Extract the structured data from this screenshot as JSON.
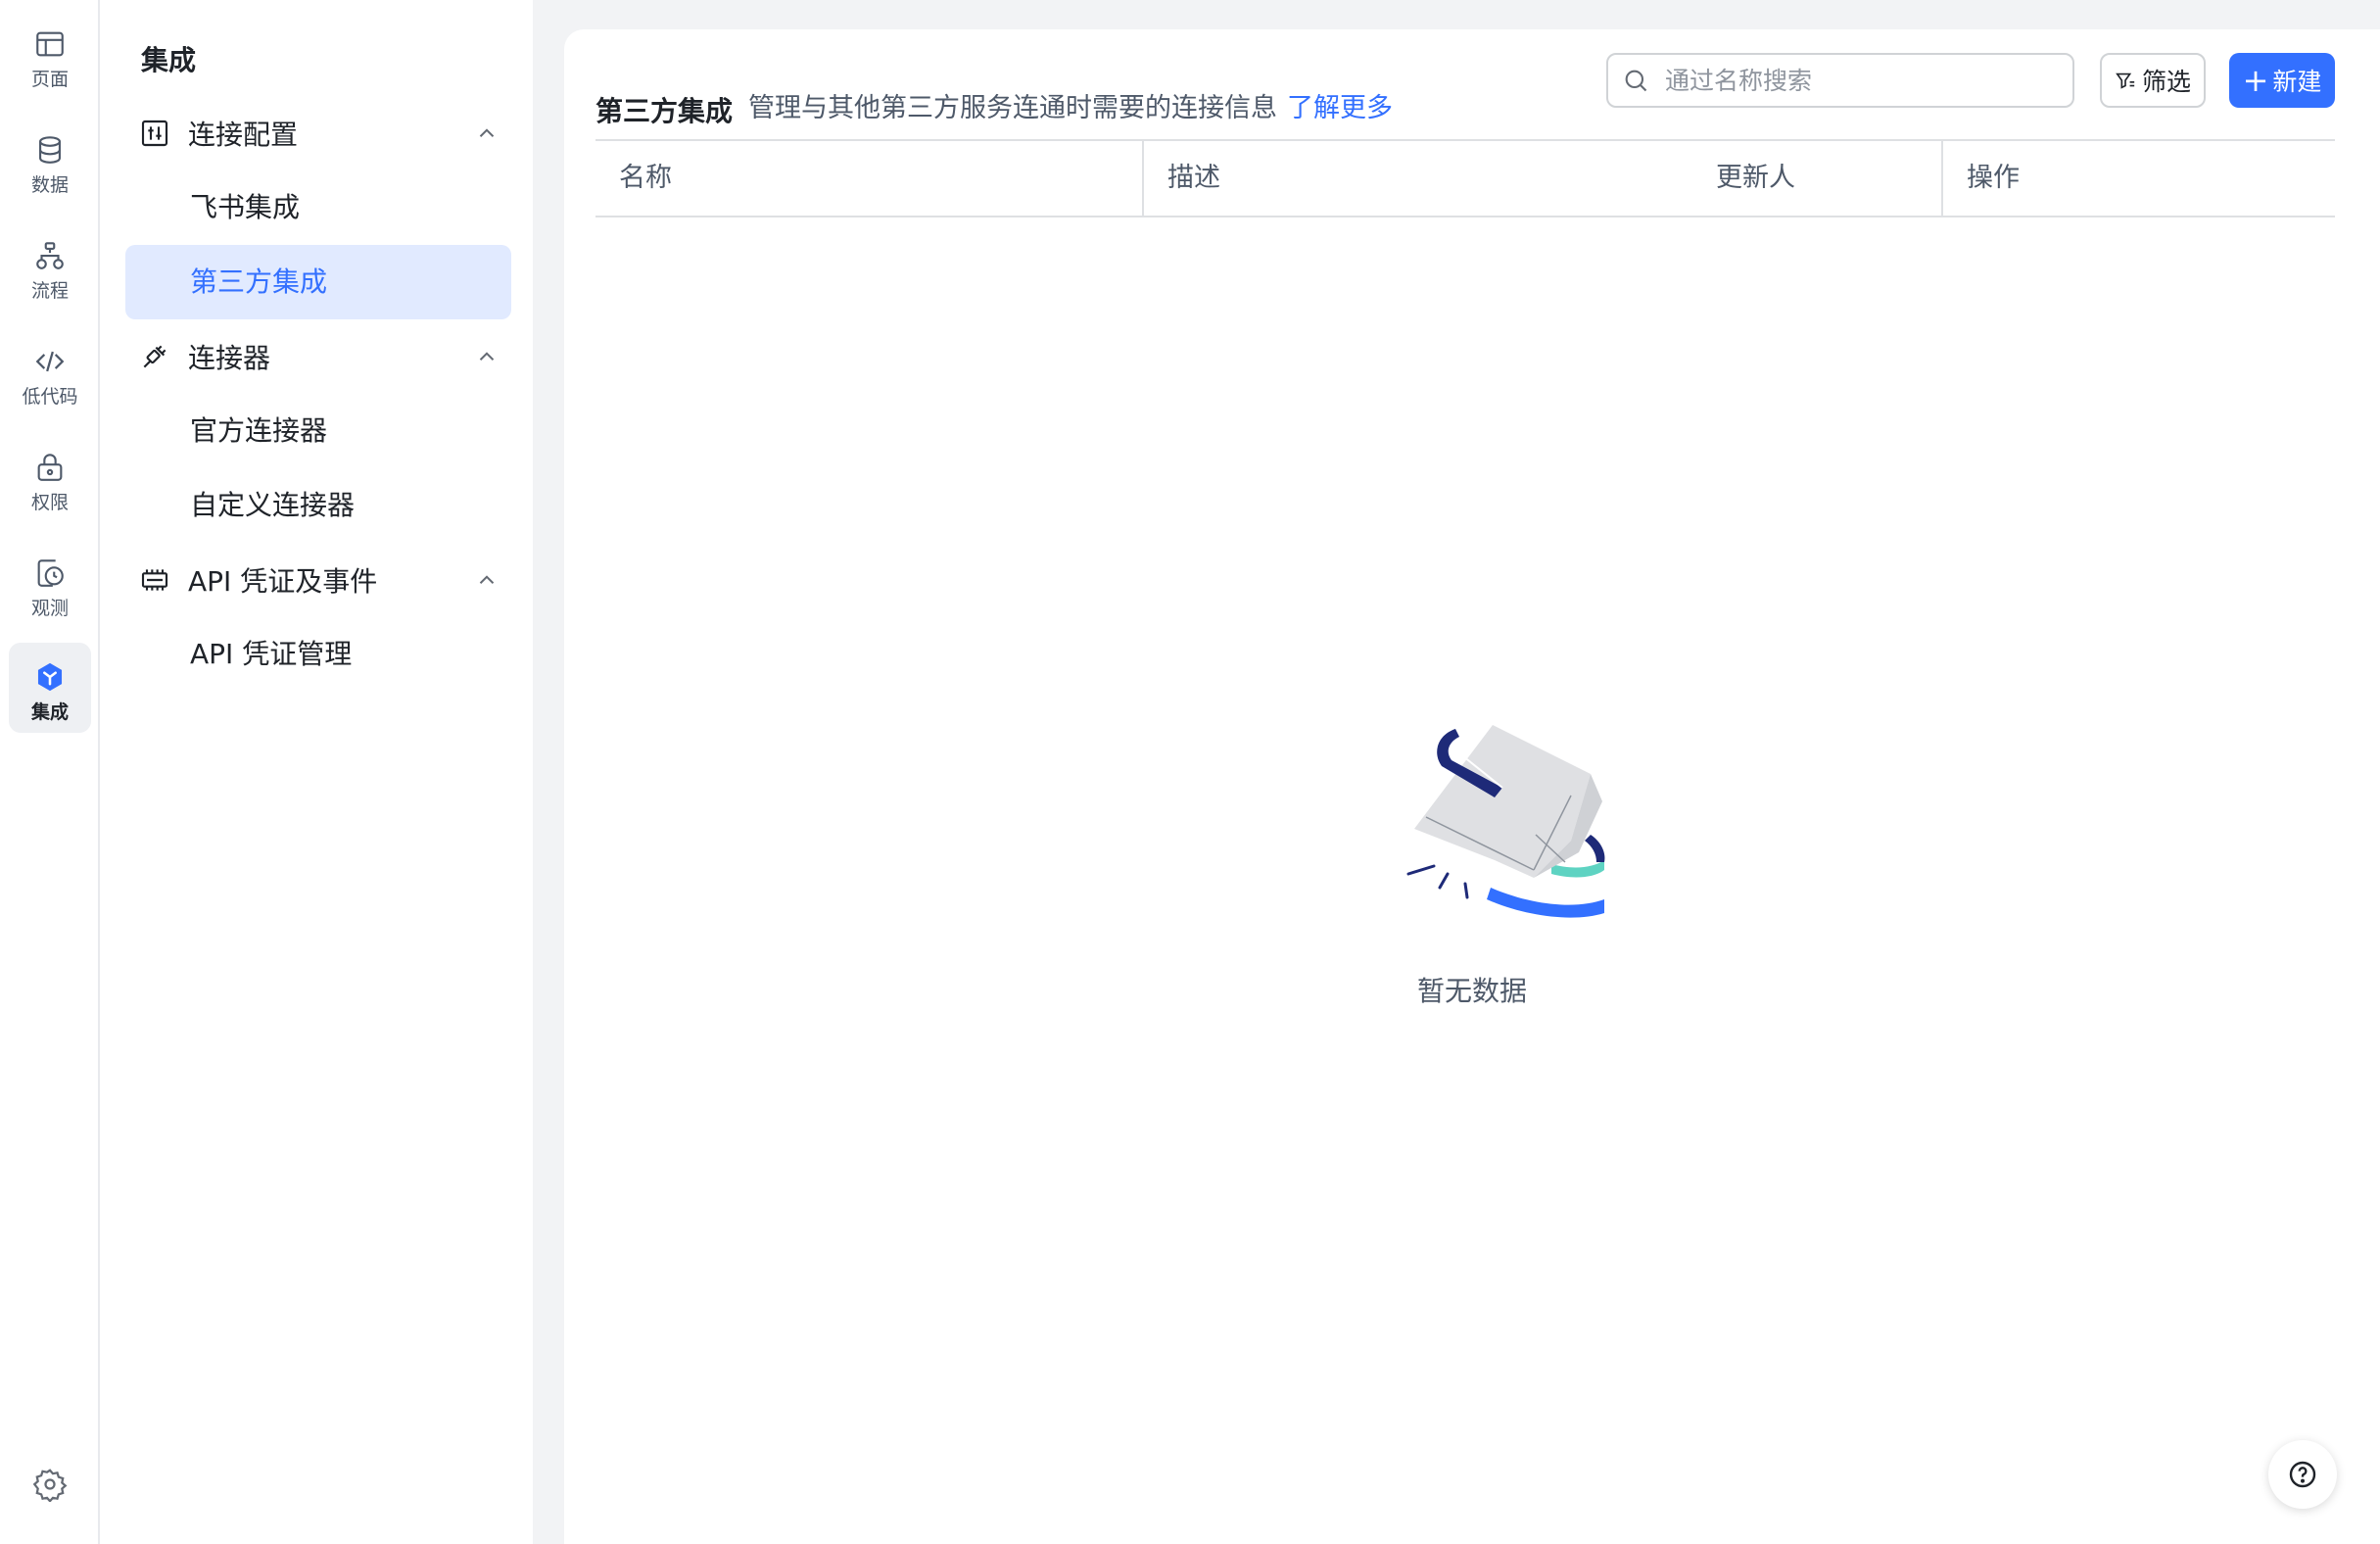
{
  "rail": {
    "items": [
      {
        "label": "页面",
        "icon": "layout-icon"
      },
      {
        "label": "数据",
        "icon": "database-icon"
      },
      {
        "label": "流程",
        "icon": "workflow-icon"
      },
      {
        "label": "低代码",
        "icon": "code-icon"
      },
      {
        "label": "权限",
        "icon": "lock-icon"
      },
      {
        "label": "观测",
        "icon": "monitor-icon"
      },
      {
        "label": "集成",
        "icon": "integration-icon",
        "active": true
      }
    ],
    "settings_icon": "gear-icon"
  },
  "subnav": {
    "title": "集成",
    "groups": [
      {
        "label": "连接配置",
        "icon": "config-icon",
        "items": [
          {
            "label": "飞书集成"
          },
          {
            "label": "第三方集成",
            "active": true
          }
        ]
      },
      {
        "label": "连接器",
        "icon": "plug-icon",
        "items": [
          {
            "label": "官方连接器"
          },
          {
            "label": "自定义连接器"
          }
        ]
      },
      {
        "label": "API 凭证及事件",
        "icon": "chip-icon",
        "items": [
          {
            "label": "API 凭证管理"
          }
        ]
      }
    ]
  },
  "main": {
    "title": "第三方集成",
    "description": "管理与其他第三方服务连通时需要的连接信息",
    "learn_more": "了解更多",
    "search_placeholder": "通过名称搜索",
    "filter_label": "筛选",
    "new_label": "新建",
    "table": {
      "columns": [
        "名称",
        "描述",
        "更新人",
        "操作"
      ],
      "rows": []
    },
    "empty_text": "暂无数据"
  },
  "colors": {
    "accent": "#3370ff",
    "active_bg": "#e1eaff",
    "text_primary": "#1f2329",
    "text_secondary": "#4e5969",
    "placeholder": "#8f959e",
    "border": "#dee0e3",
    "page_bg": "#f2f3f5",
    "illustration_navy": "#1e2a78",
    "illustration_teal": "#5ed3c2"
  }
}
